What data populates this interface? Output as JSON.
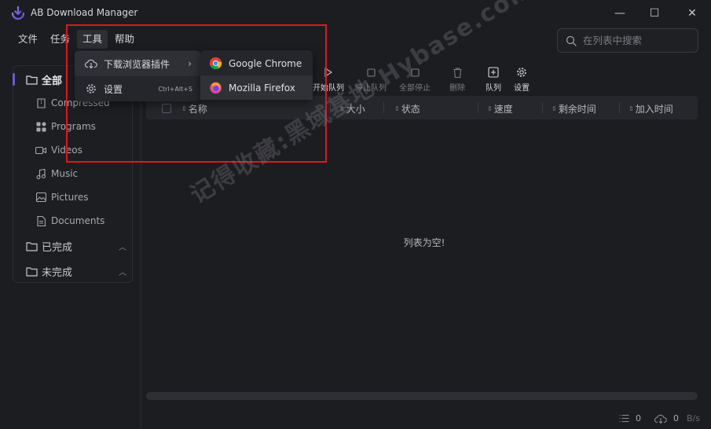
{
  "window": {
    "title": "AB Download Manager",
    "controls": {
      "minimize": "—",
      "maximize": "☐",
      "close": "✕"
    }
  },
  "menubar": {
    "items": [
      "文件",
      "任务",
      "工具",
      "帮助"
    ],
    "active_index": 2
  },
  "search": {
    "placeholder": "在列表中搜索",
    "value": ""
  },
  "sidebar": {
    "root": "全部",
    "categories": [
      "Compressed",
      "Programs",
      "Videos",
      "Music",
      "Pictures",
      "Documents"
    ],
    "groups": [
      "已完成",
      "未完成"
    ]
  },
  "toolbar": {
    "buttons": [
      "开始队列",
      "停止队列",
      "全部停止",
      "删除",
      "队列",
      "设置"
    ]
  },
  "table": {
    "columns": [
      "名称",
      "大小",
      "状态",
      "速度",
      "剩余时间",
      "加入时间"
    ],
    "empty_text": "列表为空!"
  },
  "status_bar": {
    "queue_count": "0",
    "speed_value": "0",
    "speed_unit": "B/s"
  },
  "tools_menu": {
    "items": [
      {
        "label": "下载浏览器插件",
        "icon": "cloud-download-icon",
        "arrow": "›"
      },
      {
        "label": "设置",
        "icon": "gear-icon",
        "shortcut": "Ctrl+Alt+S"
      }
    ]
  },
  "browser_submenu": {
    "items": [
      {
        "label": "Google Chrome",
        "icon": "chrome-icon"
      },
      {
        "label": "Mozilla Firefox",
        "icon": "firefox-icon"
      }
    ]
  },
  "watermark": "记得收藏:黑域基地   Hybase.com",
  "colors": {
    "accent": "#6a5cd6",
    "highlight": "#e01818",
    "background": "#1c1d21"
  }
}
